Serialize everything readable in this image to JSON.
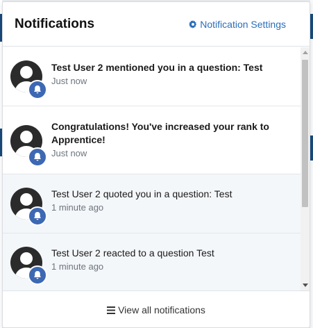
{
  "panel": {
    "title": "Notifications",
    "settings_label": "Notification Settings",
    "settings_icon": "gear-icon",
    "footer_label": "View all notifications",
    "footer_icon": "bars-icon"
  },
  "notifications": [
    {
      "message": "Test User 2 mentioned you in a question: Test",
      "time": "Just now",
      "unread": true,
      "avatar": "user-avatar-icon",
      "badge": "bell-icon"
    },
    {
      "message": "Congratulations! You've increased your rank to Apprentice!",
      "time": "Just now",
      "unread": true,
      "avatar": "user-avatar-icon",
      "badge": "bell-icon"
    },
    {
      "message": "Test User 2 quoted you in a question: Test",
      "time": "1 minute ago",
      "unread": false,
      "avatar": "user-avatar-icon",
      "badge": "bell-icon"
    },
    {
      "message": "Test User 2 reacted to a question Test",
      "time": "1 minute ago",
      "unread": false,
      "avatar": "user-avatar-icon",
      "badge": "bell-icon"
    }
  ],
  "colors": {
    "accent": "#2a6ebb",
    "badge": "#3d68b3",
    "read_bg": "#f4f7fa",
    "avatar": "#2b2b2b"
  }
}
